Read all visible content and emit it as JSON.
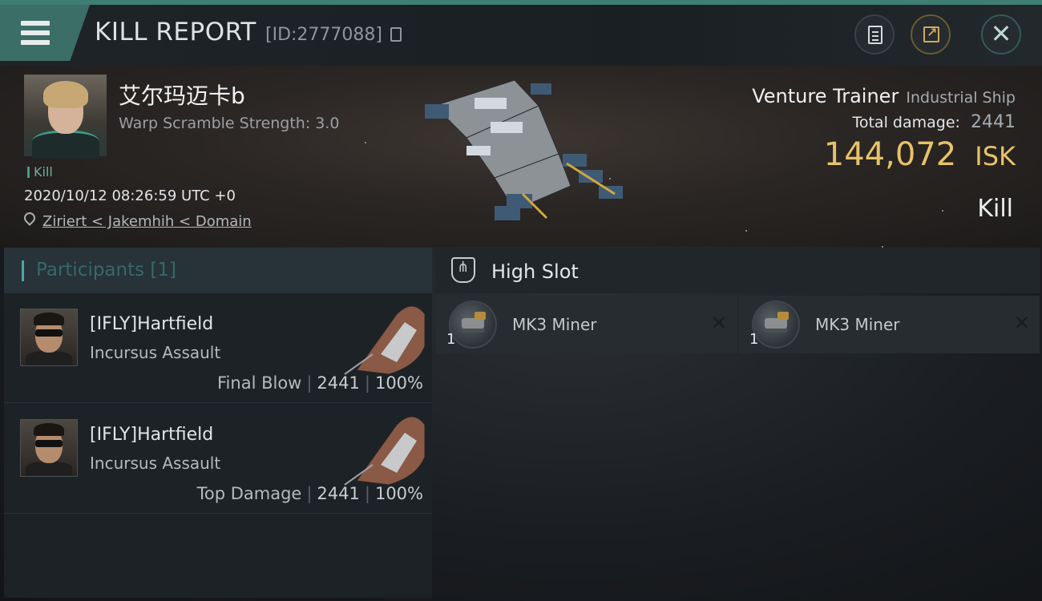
{
  "header": {
    "title": "KILL REPORT",
    "report_id": "[ID:2777088]",
    "icons": [
      "menu-icon",
      "copy-icon",
      "document-icon",
      "share-icon",
      "close-icon"
    ]
  },
  "victim": {
    "name": "艾尔玛迈卡b",
    "warp_scramble": "Warp Scramble Strength: 3.0",
    "tag": "Kill",
    "timestamp": "2020/10/12 08:26:59 UTC +0",
    "location": "Ziriert < Jakemhih < Domain",
    "ship_name": "Venture Trainer",
    "ship_class": "Industrial Ship",
    "total_damage_label": "Total damage:",
    "total_damage": "2441",
    "isk_value": "144,072",
    "isk_unit": "ISK",
    "result": "Kill"
  },
  "participants": {
    "title": "Participants [1]",
    "rows": [
      {
        "name": "[IFLY]Hartfield",
        "ship": "Incursus Assault",
        "role": "Final Blow",
        "damage": "2441",
        "percent": "100%"
      },
      {
        "name": "[IFLY]Hartfield",
        "ship": "Incursus Assault",
        "role": "Top Damage",
        "damage": "2441",
        "percent": "100%"
      }
    ]
  },
  "high_slot": {
    "title": "High Slot",
    "items": [
      {
        "name": "MK3 Miner",
        "qty": "1"
      },
      {
        "name": "MK3 Miner",
        "qty": "1"
      }
    ]
  },
  "colors": {
    "accent": "#3f7f73",
    "isk": "#e8c26a",
    "participants_title": "#36696a"
  }
}
